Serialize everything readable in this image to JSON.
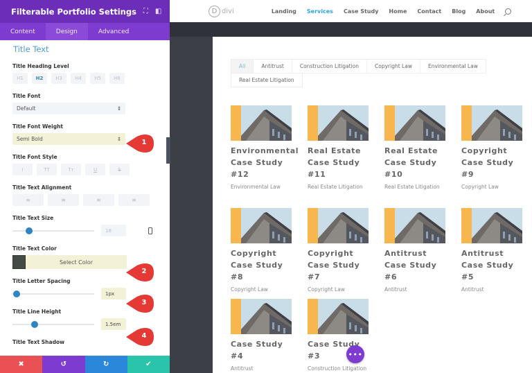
{
  "panel": {
    "title": "Filterable Portfolio Settings",
    "header_icons": [
      "expand-icon",
      "sidebar-layout-icon"
    ],
    "tabs": [
      {
        "label": "Content",
        "active": false
      },
      {
        "label": "Design",
        "active": true
      },
      {
        "label": "Advanced",
        "active": false
      }
    ],
    "section_title": "Title Text",
    "heading_level": {
      "label": "Title Heading Level",
      "options": [
        "H1",
        "H2",
        "H3",
        "H4",
        "H5",
        "H6"
      ],
      "selected": "H2"
    },
    "title_font": {
      "label": "Title Font",
      "value": "Default"
    },
    "title_font_weight": {
      "label": "Title Font Weight",
      "value": "Semi Bold"
    },
    "title_font_style": {
      "label": "Title Font Style",
      "options": [
        "I",
        "TT",
        "Tт",
        "U",
        "S"
      ]
    },
    "title_text_alignment": {
      "label": "Title Text Alignment",
      "options": [
        "left",
        "center",
        "right",
        "justify"
      ]
    },
    "title_text_size": {
      "label": "Title Text Size",
      "value": "18",
      "slider_fraction": 0.2
    },
    "title_text_color": {
      "label": "Title Text Color",
      "button_label": "Select Color",
      "swatch": "#434b44"
    },
    "title_letter_spacing": {
      "label": "Title Letter Spacing",
      "value": "1px",
      "slider_fraction": 0.05
    },
    "title_line_height": {
      "label": "Title Line Height",
      "value": "1.5em",
      "slider_fraction": 0.27
    },
    "next_label_partial": "Title Text Shadow",
    "badges": [
      "1",
      "2",
      "3",
      "4"
    ],
    "footer": {
      "cancel": "✖",
      "undo": "↺",
      "redo": "↻",
      "save": "✔"
    }
  },
  "site": {
    "logo_letter": "D",
    "logo_text": "divi",
    "menu": [
      {
        "label": "Landing",
        "active": false
      },
      {
        "label": "Services",
        "active": true
      },
      {
        "label": "Case Study",
        "active": false
      },
      {
        "label": "Home",
        "active": false
      },
      {
        "label": "Contact",
        "active": false
      },
      {
        "label": "Blog",
        "active": false
      },
      {
        "label": "About",
        "active": false
      }
    ],
    "filters": [
      {
        "label": "All",
        "active": true
      },
      {
        "label": "Antitrust",
        "active": false
      },
      {
        "label": "Construction Litigation",
        "active": false
      },
      {
        "label": "Copyright Law",
        "active": false
      },
      {
        "label": "Environmental Law",
        "active": false
      },
      {
        "label": "Real Estate Litigation",
        "active": false
      }
    ],
    "projects": [
      {
        "title": "Environmental Case Study #12",
        "category": "Environmental Law"
      },
      {
        "title": "Real Estate Case Study #11",
        "category": "Real Estate Litigation"
      },
      {
        "title": "Real Estate Case Study #10",
        "category": "Real Estate Litigation"
      },
      {
        "title": "Copyright Case Study #9",
        "category": "Copyright Law"
      },
      {
        "title": "Copyright Case Study #8",
        "category": "Copyright Law"
      },
      {
        "title": "Copyright Case Study #7",
        "category": "Copyright Law"
      },
      {
        "title": "Antitrust Case Study #6",
        "category": "Antitrust"
      },
      {
        "title": "Antitrust Case Study #5",
        "category": "Antitrust"
      },
      {
        "title": "Case Study #4",
        "category": "Antitrust"
      },
      {
        "title": "Case Study #3",
        "category": "Construction Litigation"
      }
    ],
    "fab_label": "•••"
  },
  "colors": {
    "panel_header": "#6c2eb9",
    "accent_blue": "#2d86c1",
    "nav_active": "#2ea3f2",
    "badge_red": "#e53935",
    "thumb_stripe": "#f8b74e"
  }
}
